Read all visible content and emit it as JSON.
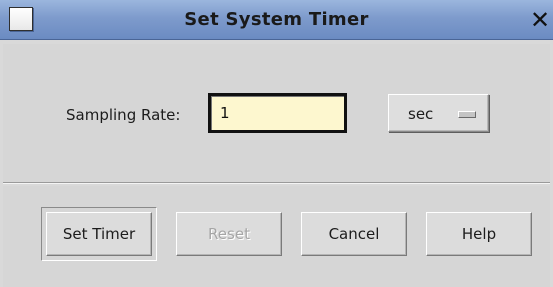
{
  "window": {
    "title": "Set System Timer",
    "close_glyph": "✕"
  },
  "form": {
    "rate_label": "Sampling Rate:",
    "rate_value": "1",
    "unit_value": "sec"
  },
  "buttons": {
    "set_timer": "Set Timer",
    "reset": "Reset",
    "cancel": "Cancel",
    "help": "Help"
  },
  "icons": {
    "window_menu": "window-menu-icon",
    "close": "close-icon"
  },
  "colors": {
    "titlebar": "#7e9bcc",
    "input_bg": "#fdf7cf",
    "disabled_text": "#a6a6a6"
  }
}
